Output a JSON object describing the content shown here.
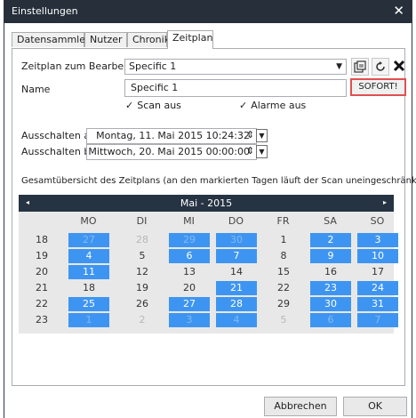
{
  "window": {
    "title": "Einstellungen",
    "close_glyph": "✕"
  },
  "tabs": [
    {
      "label": "Datensammler"
    },
    {
      "label": "Nutzer"
    },
    {
      "label": "Chronik"
    },
    {
      "label": "Zeitplan",
      "active": true
    }
  ],
  "schedule": {
    "edit_label": "Zeitplan zum Bearbeiten:",
    "selected": "Specific 1",
    "name_label": "Name",
    "name_value": "Specific 1",
    "sofort_label": "SOFORT!",
    "scan_off_label": "Scan aus",
    "alarms_off_label": "Alarme aus",
    "icons": [
      "properties-icon",
      "refresh-icon",
      "delete-icon"
    ]
  },
  "times": {
    "off_from_label": "Ausschalten ab",
    "off_from_value": "Montag, 11. Mai 2015 10:24:32",
    "off_to_label": "Ausschalten bis",
    "off_to_value": "Mittwoch, 20. Mai 2015 00:00:00"
  },
  "calendar": {
    "overview_label": "Gesamtübersicht des Zeitplans (an den markierten Tagen läuft der Scan uneingeschränkt)",
    "month_label": "Mai - 2015",
    "prev": "◂",
    "next": "▸",
    "weekdays": [
      "MO",
      "DI",
      "MI",
      "DO",
      "FR",
      "SA",
      "SO"
    ],
    "weeks": [
      {
        "week": "18",
        "days": [
          {
            "d": "27",
            "marked": true,
            "other": true
          },
          {
            "d": "28",
            "marked": false,
            "other": true
          },
          {
            "d": "29",
            "marked": true,
            "other": true
          },
          {
            "d": "30",
            "marked": true,
            "other": true
          },
          {
            "d": "1",
            "marked": false,
            "other": false
          },
          {
            "d": "2",
            "marked": true,
            "other": false
          },
          {
            "d": "3",
            "marked": true,
            "other": false
          }
        ]
      },
      {
        "week": "19",
        "days": [
          {
            "d": "4",
            "marked": true,
            "other": false
          },
          {
            "d": "5",
            "marked": false,
            "other": false
          },
          {
            "d": "6",
            "marked": true,
            "other": false
          },
          {
            "d": "7",
            "marked": true,
            "other": false
          },
          {
            "d": "8",
            "marked": false,
            "other": false
          },
          {
            "d": "9",
            "marked": true,
            "other": false
          },
          {
            "d": "10",
            "marked": true,
            "other": false
          }
        ]
      },
      {
        "week": "20",
        "days": [
          {
            "d": "11",
            "marked": true,
            "other": false
          },
          {
            "d": "12",
            "marked": false,
            "other": false
          },
          {
            "d": "13",
            "marked": false,
            "other": false
          },
          {
            "d": "14",
            "marked": false,
            "other": false
          },
          {
            "d": "15",
            "marked": false,
            "other": false
          },
          {
            "d": "16",
            "marked": false,
            "other": false
          },
          {
            "d": "17",
            "marked": false,
            "other": false
          }
        ]
      },
      {
        "week": "21",
        "days": [
          {
            "d": "18",
            "marked": false,
            "other": false
          },
          {
            "d": "19",
            "marked": false,
            "other": false
          },
          {
            "d": "20",
            "marked": false,
            "other": false
          },
          {
            "d": "21",
            "marked": true,
            "other": false
          },
          {
            "d": "22",
            "marked": false,
            "other": false
          },
          {
            "d": "23",
            "marked": true,
            "other": false
          },
          {
            "d": "24",
            "marked": true,
            "other": false
          }
        ]
      },
      {
        "week": "22",
        "days": [
          {
            "d": "25",
            "marked": true,
            "other": false
          },
          {
            "d": "26",
            "marked": false,
            "other": false
          },
          {
            "d": "27",
            "marked": true,
            "other": false
          },
          {
            "d": "28",
            "marked": true,
            "other": false
          },
          {
            "d": "29",
            "marked": false,
            "other": false
          },
          {
            "d": "30",
            "marked": true,
            "other": false
          },
          {
            "d": "31",
            "marked": true,
            "other": false
          }
        ]
      },
      {
        "week": "23",
        "days": [
          {
            "d": "1",
            "marked": true,
            "other": true
          },
          {
            "d": "2",
            "marked": false,
            "other": true
          },
          {
            "d": "3",
            "marked": true,
            "other": true
          },
          {
            "d": "4",
            "marked": true,
            "other": true
          },
          {
            "d": "5",
            "marked": false,
            "other": true
          },
          {
            "d": "6",
            "marked": true,
            "other": true
          },
          {
            "d": "7",
            "marked": true,
            "other": true
          }
        ]
      }
    ]
  },
  "buttons": {
    "cancel": "Abbrechen",
    "ok": "OK"
  },
  "colors": {
    "titlebar": "#262f3a",
    "marked_day": "#3e95f1",
    "calendar_header": "#263343",
    "highlight_border": "#e05050"
  }
}
